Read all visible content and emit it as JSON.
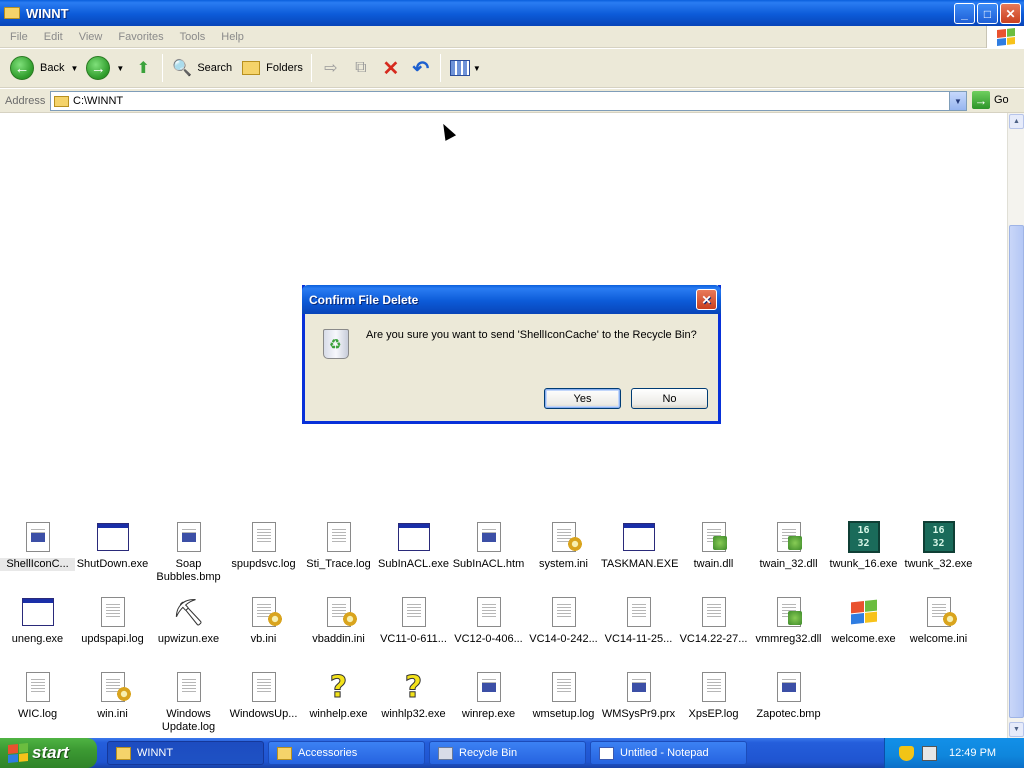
{
  "window": {
    "title": "WINNT"
  },
  "menu": [
    "File",
    "Edit",
    "View",
    "Favorites",
    "Tools",
    "Help"
  ],
  "toolbar": {
    "back": "Back",
    "search": "Search",
    "folders": "Folders"
  },
  "address": {
    "label": "Address",
    "value": "C:\\WINNT",
    "go": "Go"
  },
  "dialog": {
    "title": "Confirm File Delete",
    "message": "Are you sure you want to send 'ShellIconCache' to the Recycle Bin?",
    "yes": "Yes",
    "no": "No"
  },
  "files": [
    {
      "label": "ShellIconC...",
      "type": "imgdoc"
    },
    {
      "label": "ShutDown.exe",
      "type": "win"
    },
    {
      "label": "Soap Bubbles.bmp",
      "type": "imgdoc",
      "two": true
    },
    {
      "label": "spupdsvc.log",
      "type": "doc"
    },
    {
      "label": "Sti_Trace.log",
      "type": "doc"
    },
    {
      "label": "SubInACL.exe",
      "type": "win"
    },
    {
      "label": "SubInACL.htm",
      "type": "imgdoc"
    },
    {
      "label": "system.ini",
      "type": "gear"
    },
    {
      "label": "TASKMAN.EXE",
      "type": "win"
    },
    {
      "label": "twain.dll",
      "type": "dll"
    },
    {
      "label": "twain_32.dll",
      "type": "dll"
    },
    {
      "label": "twunk_16.exe",
      "type": "b1632"
    },
    {
      "label": "twunk_32.exe",
      "type": "b1632"
    },
    {
      "label": "uneng.exe",
      "type": "win"
    },
    {
      "label": "updspapi.log",
      "type": "doc"
    },
    {
      "label": "upwizun.exe",
      "type": "pickaxe"
    },
    {
      "label": "vb.ini",
      "type": "gear"
    },
    {
      "label": "vbaddin.ini",
      "type": "gear"
    },
    {
      "label": "VC11-0-611...",
      "type": "doc"
    },
    {
      "label": "VC12-0-406...",
      "type": "doc"
    },
    {
      "label": "VC14-0-242...",
      "type": "doc"
    },
    {
      "label": "VC14-11-25...",
      "type": "doc"
    },
    {
      "label": "VC14.22-27...",
      "type": "doc"
    },
    {
      "label": "vmmreg32.dll",
      "type": "dll"
    },
    {
      "label": "welcome.exe",
      "type": "msflag"
    },
    {
      "label": "welcome.ini",
      "type": "gear"
    },
    {
      "label": "WIC.log",
      "type": "doc"
    },
    {
      "label": "win.ini",
      "type": "gear"
    },
    {
      "label": "Windows Update.log",
      "type": "doc",
      "two": true
    },
    {
      "label": "WindowsUp...",
      "type": "doc"
    },
    {
      "label": "winhelp.exe",
      "type": "help"
    },
    {
      "label": "winhlp32.exe",
      "type": "help"
    },
    {
      "label": "winrep.exe",
      "type": "imgdoc"
    },
    {
      "label": "wmsetup.log",
      "type": "doc"
    },
    {
      "label": "WMSysPr9.prx",
      "type": "imgdoc"
    },
    {
      "label": "XpsEP.log",
      "type": "doc"
    },
    {
      "label": "Zapotec.bmp",
      "type": "imgdoc"
    }
  ],
  "taskbar": {
    "start": "start",
    "buttons": [
      "WINNT",
      "Accessories",
      "Recycle Bin",
      "Untitled - Notepad"
    ],
    "clock": "12:49 PM"
  }
}
